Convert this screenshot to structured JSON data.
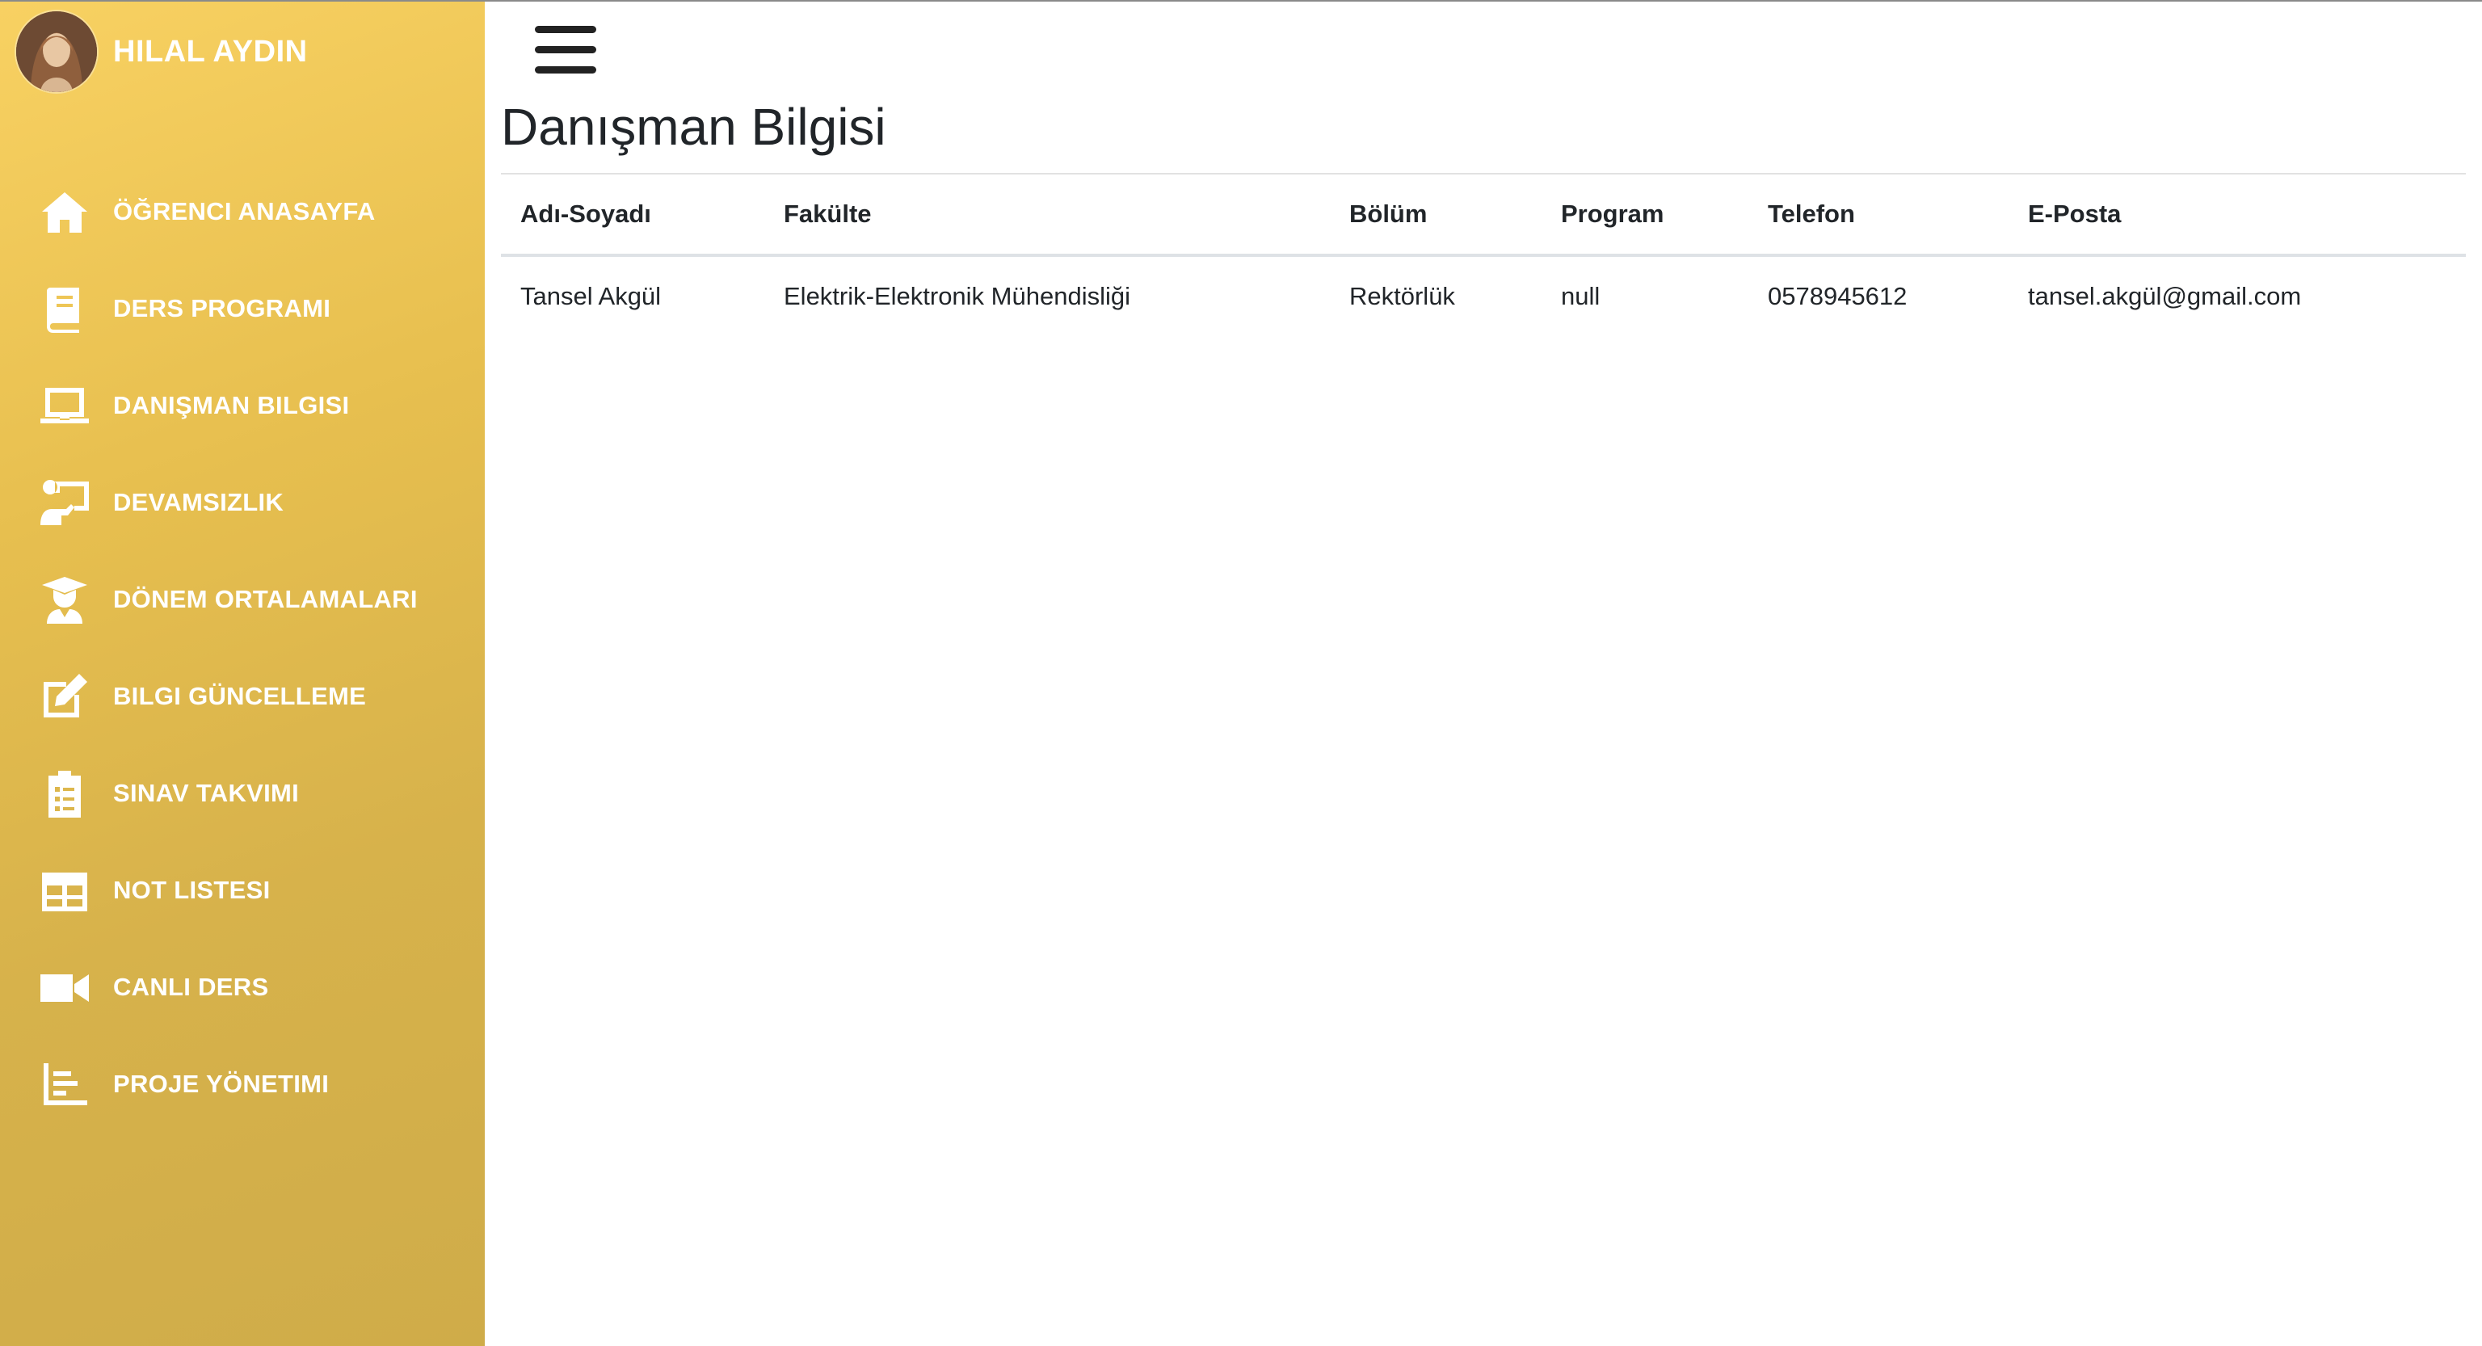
{
  "user": {
    "name": "HILAL AYDIN"
  },
  "sidebar": {
    "items": [
      {
        "label": "ÖĞRENCI ANASAYFA",
        "icon": "home-icon"
      },
      {
        "label": "DERS PROGRAMI",
        "icon": "book-icon"
      },
      {
        "label": "DANIŞMAN BILGISI",
        "icon": "laptop-icon"
      },
      {
        "label": "DEVAMSIZLIK",
        "icon": "teacher-board-icon"
      },
      {
        "label": "DÖNEM ORTALAMALARI",
        "icon": "graduate-icon"
      },
      {
        "label": "BILGI GÜNCELLEME",
        "icon": "edit-icon"
      },
      {
        "label": "SINAV TAKVIMI",
        "icon": "clipboard-list-icon"
      },
      {
        "label": "NOT LISTESI",
        "icon": "table-icon"
      },
      {
        "label": "CANLI DERS",
        "icon": "video-camera-icon"
      },
      {
        "label": "PROJE YÖNETIMI",
        "icon": "chart-bars-icon"
      }
    ]
  },
  "page": {
    "title": "Danışman Bilgisi"
  },
  "table": {
    "headers": [
      "Adı-Soyadı",
      "Fakülte",
      "Bölüm",
      "Program",
      "Telefon",
      "E-Posta"
    ],
    "rows": [
      [
        "Tansel Akgül",
        "Elektrik-Elektronik Mühendisliği",
        "Rektörlük",
        "null",
        "0578945612",
        "tansel.akgül@gmail.com"
      ]
    ]
  },
  "colors": {
    "sidebar_top": "#f8d162",
    "sidebar_bottom": "#cfac49",
    "text": "#212529"
  }
}
